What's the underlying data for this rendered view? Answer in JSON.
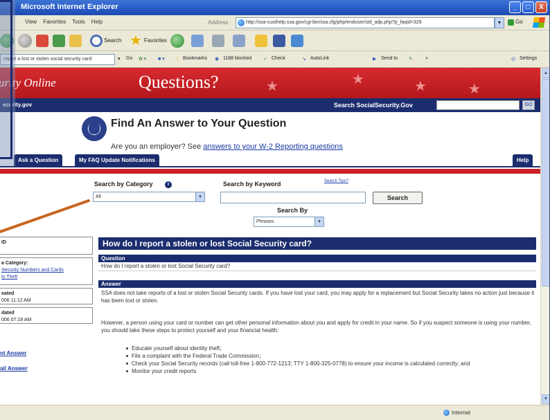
{
  "window": {
    "title": "Microsoft Internet Explorer",
    "controls": [
      "_",
      "□",
      "X"
    ]
  },
  "menu": {
    "items": [
      "View",
      "Favorites",
      "Tools",
      "Help"
    ],
    "address_label": "Address",
    "address_url": "http://ssa-custhelp.ssa.gov/cgi-bin/ssa.cfg/php/enduser/std_adp.php?p_faqid=329",
    "go_label": "Go"
  },
  "toolbar": {
    "search_label": "Search",
    "favorites_label": "Favorites"
  },
  "linksbar": {
    "google_query": "report a lost or stolen social security card",
    "go_label": "Go",
    "bookmarks": "Bookmarks",
    "blocked": "1188 blocked",
    "check": "Check",
    "autolink": "AutoLink",
    "sendto": "Send to",
    "settings": "Settings"
  },
  "header": {
    "site_name": "urity Online",
    "page_heading": "Questions?",
    "domain": "ecurity.gov",
    "search_label": "Search SocialSecurity.Gov",
    "go": "GO"
  },
  "find": {
    "heading": "Find An Answer to Your Question",
    "employer_text": "Are you an employer? See",
    "employer_link": "answers to your W-2 Reporting questions"
  },
  "nav": {
    "tabs": [
      "Ask a Question",
      "My FAQ Update Notifications"
    ],
    "help": "Help"
  },
  "search_form": {
    "category_label": "Search by Category",
    "category_value": "All",
    "keyword_label": "Search by Keyword",
    "tips_link": "Search Tips?",
    "search_button": "Search",
    "search_by_label": "Search By",
    "search_by_value": "Phrases"
  },
  "left_panel": {
    "id_label": "ID",
    "category_label": "a Category:",
    "category_link_1": "Security Numbers and Cards",
    "category_link_2": "ty Theft",
    "created_label": "eated",
    "created_value": "006 11:12 AM",
    "updated_label": "dated",
    "updated_value": "006 07:18 AM",
    "action_1": "nt Answer",
    "action_2": "ail Answer"
  },
  "content": {
    "question_title": "How do I report a stolen or lost Social Security card?",
    "question_label": "Question",
    "question_text": "How do I report a stolen or lost Social Security card?",
    "answer_label": "Answer",
    "answer_p1": "SSA does not take reports of a lost or stolen Social Security cards. If you have lost your card, you may apply for a replacement but Social Security takes no action just because it has been lost or stolen.",
    "answer_p2": "However, a person using your card or number can get other personal information about you and apply for credit in your name. So if you suspect someone is using your number, you should take these steps to protect yourself and your financial health:",
    "bullets": [
      "Educate yourself about identity theft;",
      "File a complaint with the Federal Trade Commission;",
      "Check your Social Security records (call toll-free 1-800-772-1213; TTY 1-800-325-0778) to ensure your income is calculated correctly; and",
      "Monitor your credit reports"
    ]
  },
  "status": {
    "zone": "Internet"
  },
  "colors": {
    "ssa_red": "#cc2028",
    "ssa_navy": "#1b2d6e",
    "callout_orange": "#c8641e",
    "xp_title": "#2559c4"
  }
}
